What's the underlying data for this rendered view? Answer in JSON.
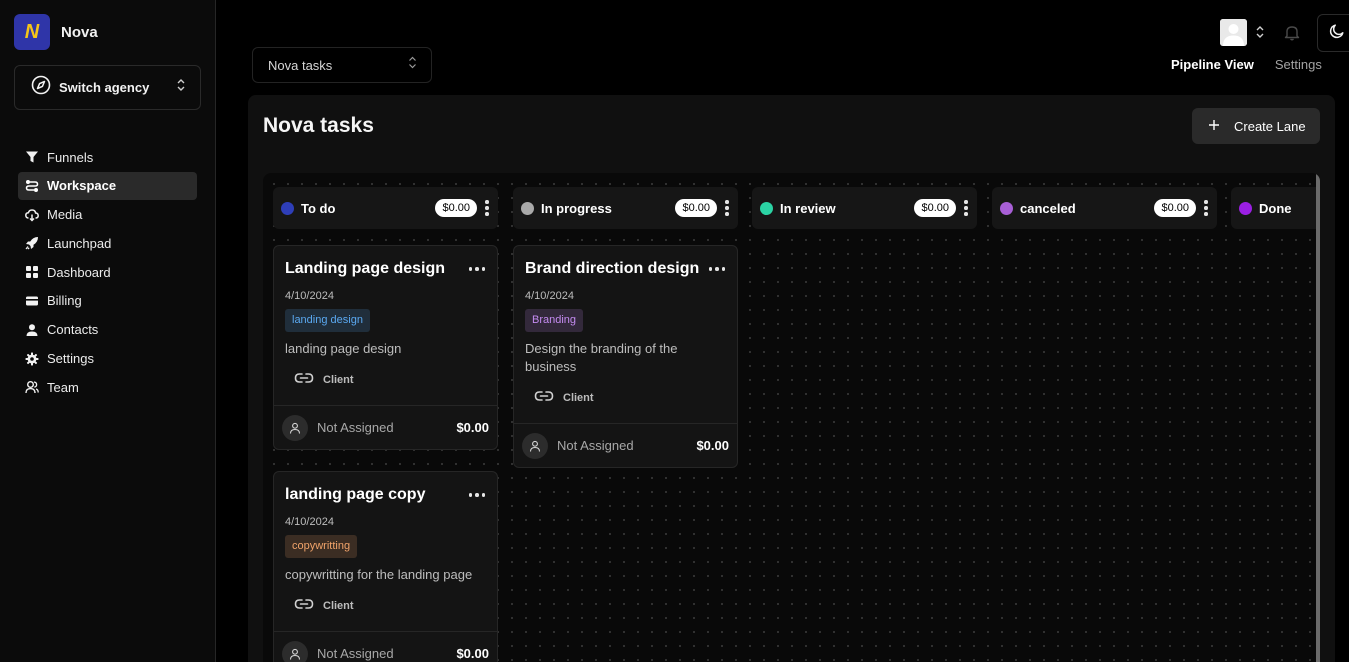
{
  "sidebar": {
    "brand_initial": "N",
    "brand_name": "Nova",
    "switch_label": "Switch agency",
    "items": [
      {
        "label": "Funnels",
        "icon": "funnel-icon",
        "active": false
      },
      {
        "label": "Workspace",
        "icon": "workspace-icon",
        "active": true
      },
      {
        "label": "Media",
        "icon": "media-icon",
        "active": false
      },
      {
        "label": "Launchpad",
        "icon": "rocket-icon",
        "active": false
      },
      {
        "label": "Dashboard",
        "icon": "dashboard-icon",
        "active": false
      },
      {
        "label": "Billing",
        "icon": "billing-icon",
        "active": false
      },
      {
        "label": "Contacts",
        "icon": "contacts-icon",
        "active": false
      },
      {
        "label": "Settings",
        "icon": "settings-icon",
        "active": false
      },
      {
        "label": "Team",
        "icon": "team-icon",
        "active": false
      }
    ]
  },
  "header": {
    "pipeline_select": "Nova tasks",
    "tabs": [
      {
        "label": "Pipeline View",
        "active": true
      },
      {
        "label": "Settings",
        "active": false
      }
    ]
  },
  "board": {
    "title": "Nova tasks",
    "create_lane_label": "Create Lane",
    "lanes": [
      {
        "title": "To do",
        "amount": "$0.00",
        "color": "#2e3eb8"
      },
      {
        "title": "In progress",
        "amount": "$0.00",
        "color": "#a9a9a9"
      },
      {
        "title": "In review",
        "amount": "$0.00",
        "color": "#2bd3a4"
      },
      {
        "title": "canceled",
        "amount": "$0.00",
        "color": "#a85fd6"
      },
      {
        "title": "Done",
        "amount": "",
        "color": "#9b1fe3"
      }
    ],
    "tickets": [
      {
        "title": "Landing page design",
        "date": "4/10/2024",
        "tag": "landing design",
        "tag_color": "#5aa8f0",
        "description": "landing page design",
        "client": "Client",
        "assignee": "Not Assigned",
        "amount": "$0.00"
      },
      {
        "title": "landing page copy",
        "date": "4/10/2024",
        "tag": "copywritting",
        "tag_color": "#f0a36a",
        "description": "copywritting for the landing page",
        "client": "Client",
        "assignee": "Not Assigned",
        "amount": "$0.00"
      },
      {
        "title": "Brand direction design",
        "date": "4/10/2024",
        "tag": "Branding",
        "tag_color": "#c48bf0",
        "description": "Design the branding of the business",
        "client": "Client",
        "assignee": "Not Assigned",
        "amount": "$0.00"
      }
    ]
  }
}
